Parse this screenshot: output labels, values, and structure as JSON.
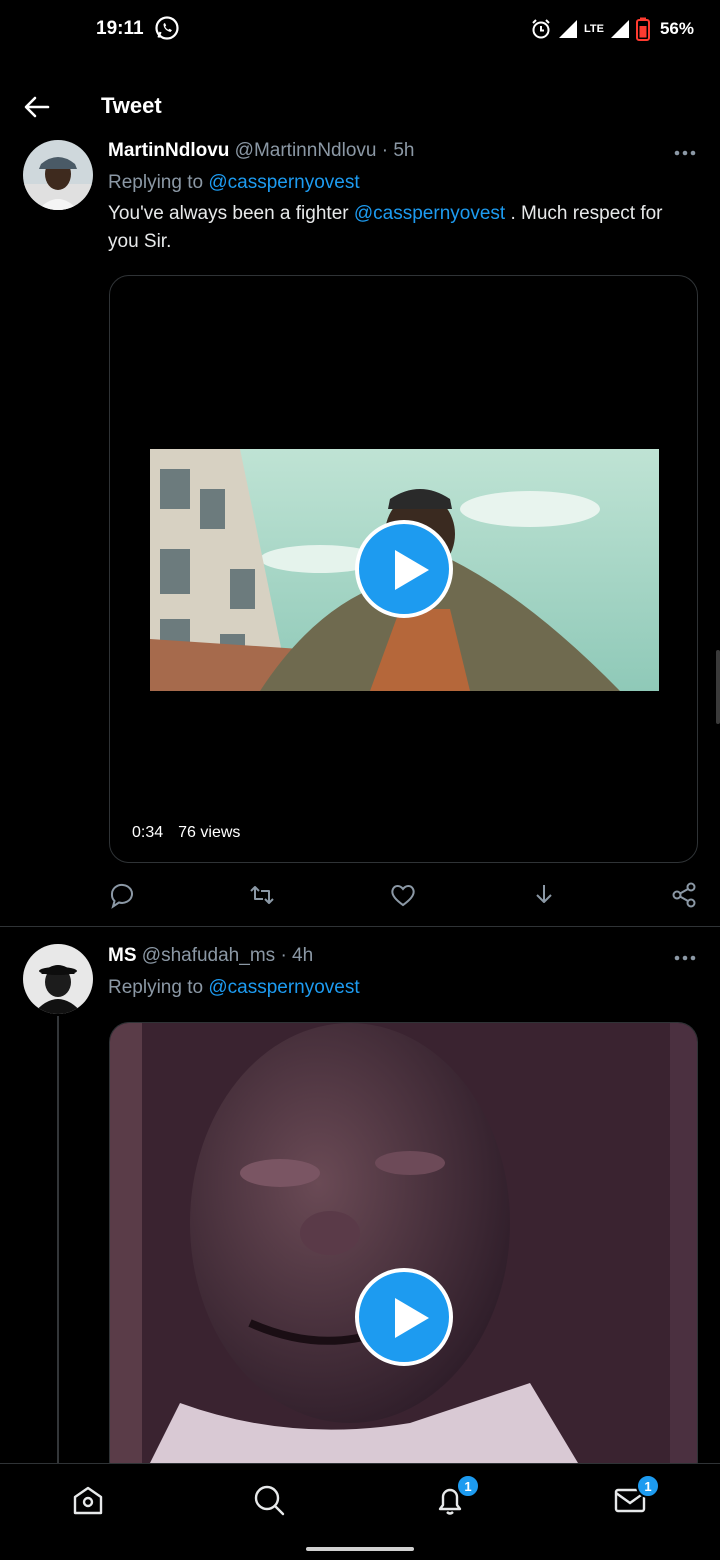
{
  "status_bar": {
    "time": "19:11",
    "battery": "56%",
    "network": "LTE"
  },
  "header": {
    "title": "Tweet"
  },
  "tweets": [
    {
      "name": "MartinNdlovu",
      "handle": "@MartinnNdlovu",
      "time": "· 5h",
      "replying_prefix": "Replying to",
      "replying_to": "@casspernyovest",
      "text_before": "You've always been a fighter",
      "text_mention": "@casspernyovest",
      "text_after": ". Much respect for you Sir.",
      "video": {
        "duration": "0:34",
        "views": "76 views"
      }
    },
    {
      "name": "MS",
      "handle": "@shafudah_ms",
      "time": "· 4h",
      "replying_prefix": "Replying to",
      "replying_to": "@casspernyovest"
    }
  ],
  "bottom_nav": {
    "items": [
      "home-icon",
      "search-icon",
      "notifications-icon",
      "messages-icon"
    ],
    "notifications_badge": "1",
    "messages_badge": "1"
  },
  "colors": {
    "accent": "#1d9bf0",
    "background": "#000000",
    "muted": "#8b98a5"
  }
}
